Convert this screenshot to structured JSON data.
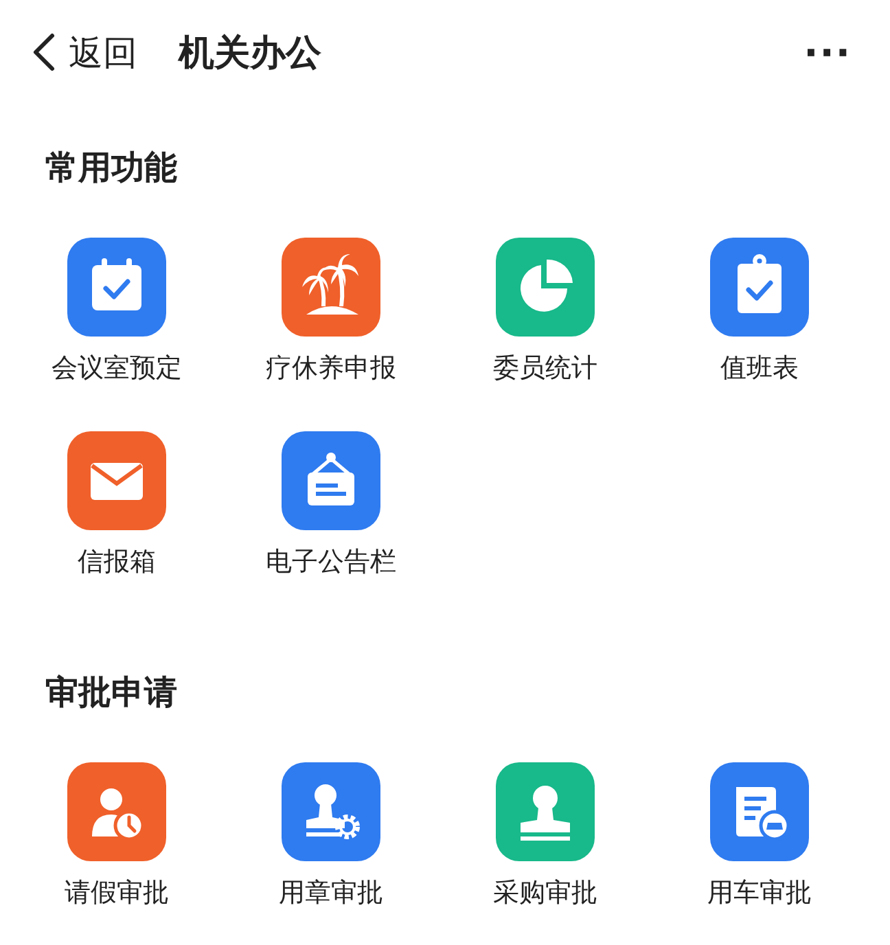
{
  "header": {
    "back_label": "返回",
    "title": "机关办公",
    "more": "···"
  },
  "sections": [
    {
      "title": "常用功能",
      "items": [
        {
          "label": "会议室预定",
          "kind": "calendar",
          "color": "#2f7bf0"
        },
        {
          "label": "疗休养申报",
          "kind": "palm",
          "color": "#f0602a"
        },
        {
          "label": "委员统计",
          "kind": "pie",
          "color": "#18b98a"
        },
        {
          "label": "值班表",
          "kind": "clipboard",
          "color": "#2f7bf0"
        },
        {
          "label": "信报箱",
          "kind": "mail",
          "color": "#f0602a"
        },
        {
          "label": "电子公告栏",
          "kind": "board",
          "color": "#2f7bf0"
        }
      ]
    },
    {
      "title": "审批申请",
      "items": [
        {
          "label": "请假审批",
          "kind": "leave",
          "color": "#f0602a"
        },
        {
          "label": "用章审批",
          "kind": "seal",
          "color": "#2f7bf0"
        },
        {
          "label": "采购审批",
          "kind": "stamp",
          "color": "#18b98a"
        },
        {
          "label": "用车审批",
          "kind": "car",
          "color": "#2f7bf0"
        }
      ]
    }
  ]
}
